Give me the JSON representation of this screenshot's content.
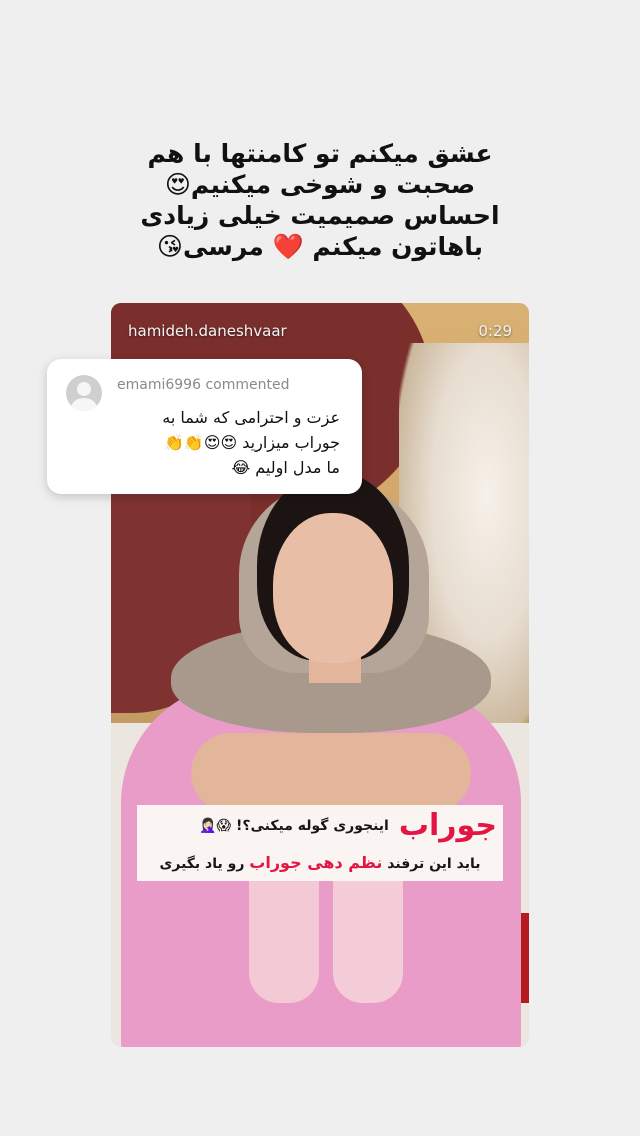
{
  "header": {
    "lines": [
      "عشق میکنم تو کامنتها با هم",
      "صحبت و شوخی میکنیم😍",
      "احساس صمیمیت خیلی زیادی",
      "باهاتون میکنم ❤️ مرسی😘"
    ]
  },
  "video": {
    "username": "hamideh.daneshvaar",
    "timer": "0:29",
    "caption": {
      "title": "جوراب",
      "line1": "اینجوری گوله میکنی؟! 😱🤦🏻‍♀️",
      "line2_pre": "باید این ترفند",
      "line2_accent": "نظم دهی جوراب",
      "line2_post": "رو یاد بگیری"
    }
  },
  "comment": {
    "user": "emami6996",
    "action": "commented",
    "lines": [
      "عزت و احترامی که شما به",
      "جوراب میزارید 😍😍👏👏",
      "ما مدل اولیم 😂"
    ]
  }
}
